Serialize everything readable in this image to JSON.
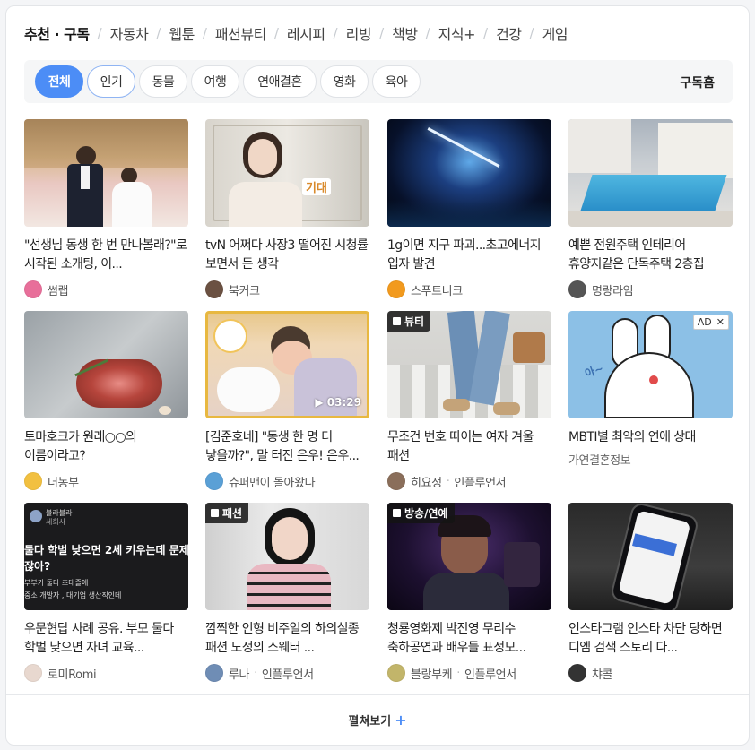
{
  "topnav": {
    "items": [
      {
        "label": "추천 · 구독",
        "active": true
      },
      {
        "label": "자동차"
      },
      {
        "label": "웹툰"
      },
      {
        "label": "패션뷰티"
      },
      {
        "label": "레시피"
      },
      {
        "label": "리빙"
      },
      {
        "label": "책방"
      },
      {
        "label": "지식+"
      },
      {
        "label": "건강"
      },
      {
        "label": "게임"
      }
    ]
  },
  "filters": {
    "chips": [
      "전체",
      "인기",
      "동물",
      "여행",
      "연애결혼",
      "영화",
      "육아"
    ],
    "selected": "전체",
    "subscribe_home": "구독홈"
  },
  "cards": [
    {
      "title": "\"선생님 동생 한 번 만나볼래?\"로 시작된 소개팅, 이...",
      "source": "썸랩"
    },
    {
      "title": "tvN 어쩌다 사장3 떨어진 시청률 보면서 든 생각",
      "source": "북커크"
    },
    {
      "title": "1g이면 지구 파괴...초고에너지 입자 발견",
      "source": "스푸트니크"
    },
    {
      "title": "예쁜 전원주택 인테리어 휴양지같은 단독주택 2층집",
      "source": "명랑라임"
    },
    {
      "title": "토마호크가 원래○○의 이름이라고?",
      "source": "더농부"
    },
    {
      "title": "[김준호네] \"동생 한 명 더 낳을까?\", 말 터진 은우! 은우...",
      "source": "슈퍼맨이 돌아왔다",
      "duration": "03:29"
    },
    {
      "title": "무조건 번호 따이는 여자 겨울 패션",
      "source": "히요정",
      "source_sub": "인플루언서",
      "badge": "뷰티"
    },
    {
      "title": "MBTI별 최악의 연애 상대",
      "source": "가연결혼정보",
      "ad": "AD"
    },
    {
      "title": "우문현답 사례 공유. 부모 둘다 학벌 낮으면 자녀 교육...",
      "source": "로미Romi",
      "thumb_lines": [
        "블라블라",
        "세회사",
        "둘다 학벌 낮으면 2세 키우는데 문제",
        "잖아?",
        "부부가 둘다 초대졸에",
        "중소 개발자 , 대기업 생산직인데"
      ]
    },
    {
      "title": "깜찍한 인형 비주얼의 하의실종 패션 노정의 스웨터 ...",
      "source": "루나",
      "source_sub": "인플루언서",
      "badge": "패션"
    },
    {
      "title": "청룡영화제 박진영 무리수 축하공연과 배우들 표정모...",
      "source": "블랑부케",
      "source_sub": "인플루언서",
      "badge": "방송/연예"
    },
    {
      "title": "인스타그램 인스타 차단 당하면 디엠 검색 스토리 다...",
      "source": "챠콜"
    }
  ],
  "thumb_texts": {
    "card2": "기대"
  },
  "footer": {
    "label": "펼쳐보기",
    "plus": "+"
  },
  "colors": {
    "accent": "#4c8df6",
    "background": "#ffffff"
  }
}
